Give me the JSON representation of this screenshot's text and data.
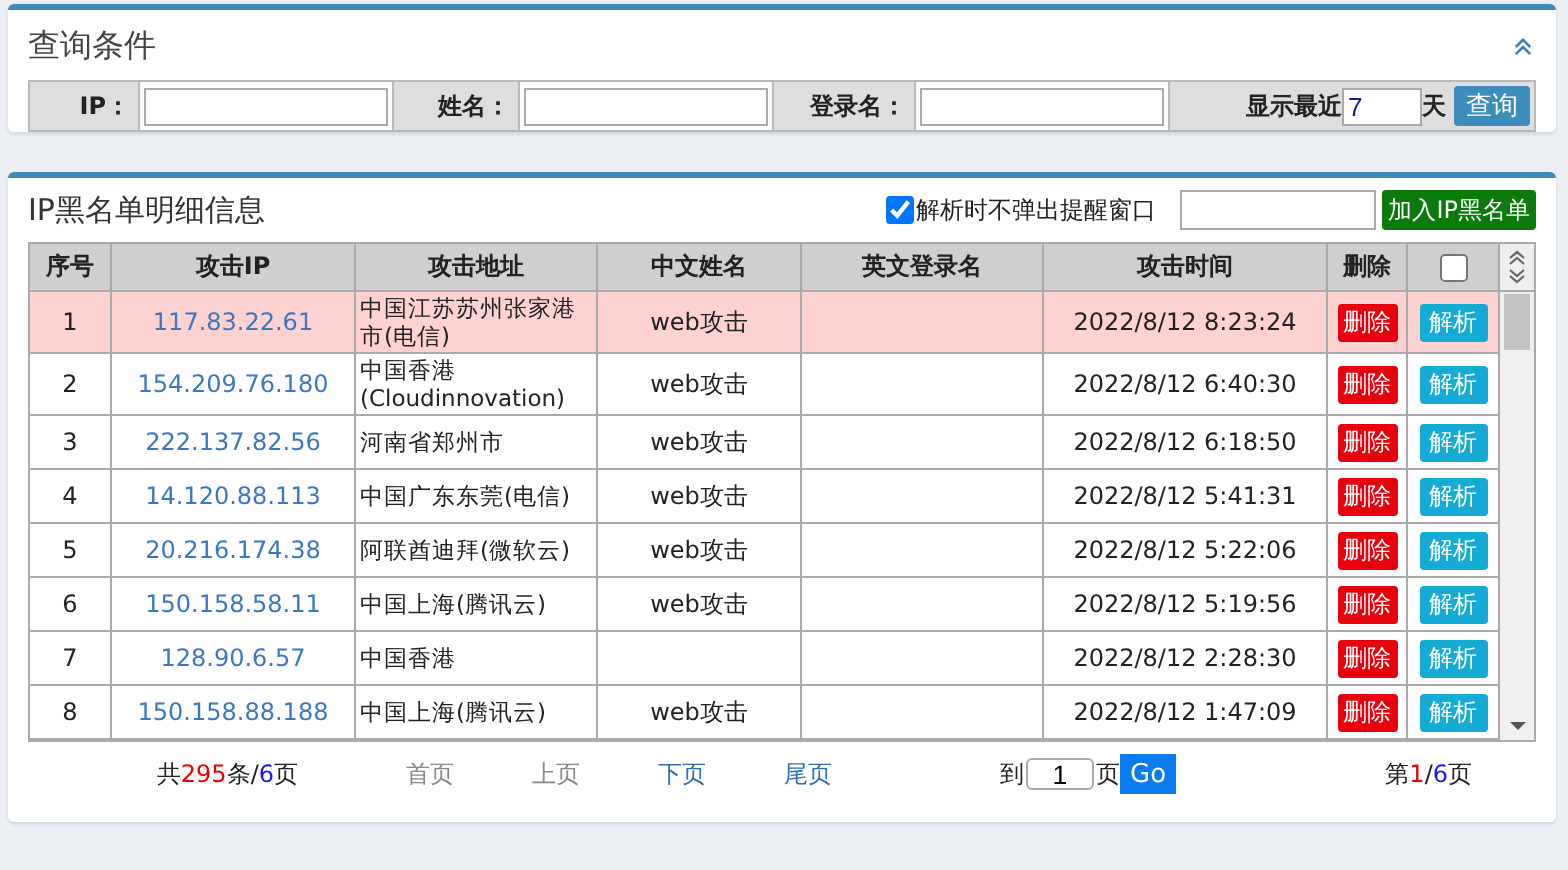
{
  "query_panel": {
    "title": "查询条件",
    "expanded": true,
    "fields": [
      {
        "label": "IP："
      },
      {
        "label": "姓名："
      },
      {
        "label": "登录名："
      }
    ],
    "recent": {
      "label": "显示最近",
      "value": "7",
      "unit": "天"
    },
    "search_button": "查询"
  },
  "detail_panel": {
    "title": "IP黑名单明细信息",
    "no_popup": {
      "label": "解析时不弹出提醒窗口",
      "checked": true
    },
    "add_button": "加入IP黑名单",
    "table": {
      "columns": [
        "序号",
        "攻击IP",
        "攻击地址",
        "中文姓名",
        "英文登录名",
        "攻击时间",
        "删除"
      ],
      "select_all": {
        "checked": false
      },
      "rows": [
        {
          "no": "1",
          "ip": "117.83.22.61",
          "address": "中国江苏苏州张家港市(电信)",
          "cn_name": "web攻击",
          "time": "2022/8/12 8:23:24",
          "delete": "删除",
          "parse": "解析",
          "selected": true
        },
        {
          "no": "2",
          "ip": "154.209.76.180",
          "address": "中国香港(Cloudinnovation)",
          "cn_name": "web攻击",
          "time": "2022/8/12 6:40:30",
          "delete": "删除",
          "parse": "解析",
          "selected": false
        },
        {
          "no": "3",
          "ip": "222.137.82.56",
          "address": "河南省郑州市",
          "cn_name": "web攻击",
          "time": "2022/8/12 6:18:50",
          "delete": "删除",
          "parse": "解析",
          "selected": false
        },
        {
          "no": "4",
          "ip": "14.120.88.113",
          "address": "中国广东东莞(电信)",
          "cn_name": "web攻击",
          "time": "2022/8/12 5:41:31",
          "delete": "删除",
          "parse": "解析",
          "selected": false
        },
        {
          "no": "5",
          "ip": "20.216.174.38",
          "address": "阿联酋迪拜(微软云)",
          "cn_name": "web攻击",
          "time": "2022/8/12 5:22:06",
          "delete": "删除",
          "parse": "解析",
          "selected": false
        },
        {
          "no": "6",
          "ip": "150.158.58.11",
          "address": "中国上海(腾讯云)",
          "cn_name": "web攻击",
          "time": "2022/8/12 5:19:56",
          "delete": "删除",
          "parse": "解析",
          "selected": false
        },
        {
          "no": "7",
          "ip": "128.90.6.57",
          "address": "中国香港",
          "time": "2022/8/12 2:28:30",
          "delete": "删除",
          "parse": "解析",
          "selected": false
        },
        {
          "no": "8",
          "ip": "150.158.88.188",
          "address": "中国上海(腾讯云)",
          "cn_name": "web攻击",
          "time": "2022/8/12 1:47:09",
          "delete": "删除",
          "parse": "解析",
          "selected": false
        }
      ]
    },
    "pagination": {
      "summary": {
        "prefix": "共",
        "total": "295",
        "middle": "条/",
        "pages": "6",
        "suffix": "页"
      },
      "links": [
        {
          "label": "首页",
          "disabled": true
        },
        {
          "label": "上页",
          "disabled": true
        },
        {
          "label": "下页",
          "disabled": false
        },
        {
          "label": "尾页",
          "disabled": false
        }
      ],
      "jump": {
        "before": "到",
        "value": "1",
        "after": "页",
        "button": "Go"
      },
      "current": {
        "prefix": "第",
        "page": "1",
        "separator": "/",
        "pages": "6",
        "suffix": "页"
      }
    }
  }
}
